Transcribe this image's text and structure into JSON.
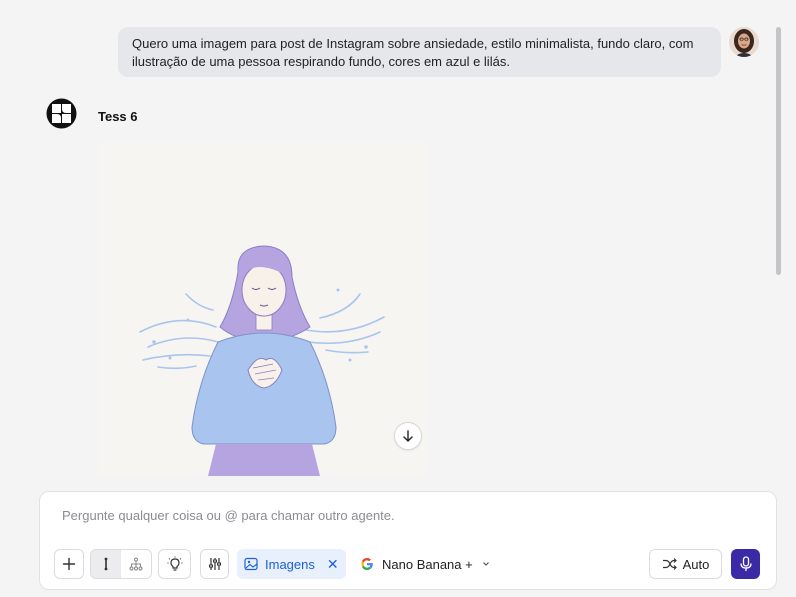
{
  "user_message": {
    "text": "Quero uma imagem para post de Instagram sobre ansiedade, estilo minimalista, fundo claro, com ilustração de uma pessoa respirando fundo, cores em azul e lilás."
  },
  "agent": {
    "name": "Tess 6"
  },
  "composer": {
    "placeholder": "Pergunte qualquer coisa ou @ para chamar outro agente.",
    "images_chip_label": "Imagens",
    "model_label": "Nano Banana +",
    "auto_label": "Auto"
  },
  "icons": {
    "add": "plus-icon",
    "mode_single": "bar-icon",
    "mode_tree": "tree-icon",
    "idea": "lightbulb-icon",
    "settings": "sliders-icon",
    "images": "image-icon",
    "close": "close-icon",
    "google": "google-icon",
    "dropdown": "chevron-down-icon",
    "shuffle": "shuffle-icon",
    "mic": "mic-icon",
    "download": "arrow-down-icon"
  },
  "colors": {
    "accent": "#3b2aa6",
    "chip_bg": "#e8f0fe",
    "chip_text": "#1d5fd6",
    "illustration_blue": "#a9c4ee",
    "illustration_lilac": "#b6a4e0"
  }
}
